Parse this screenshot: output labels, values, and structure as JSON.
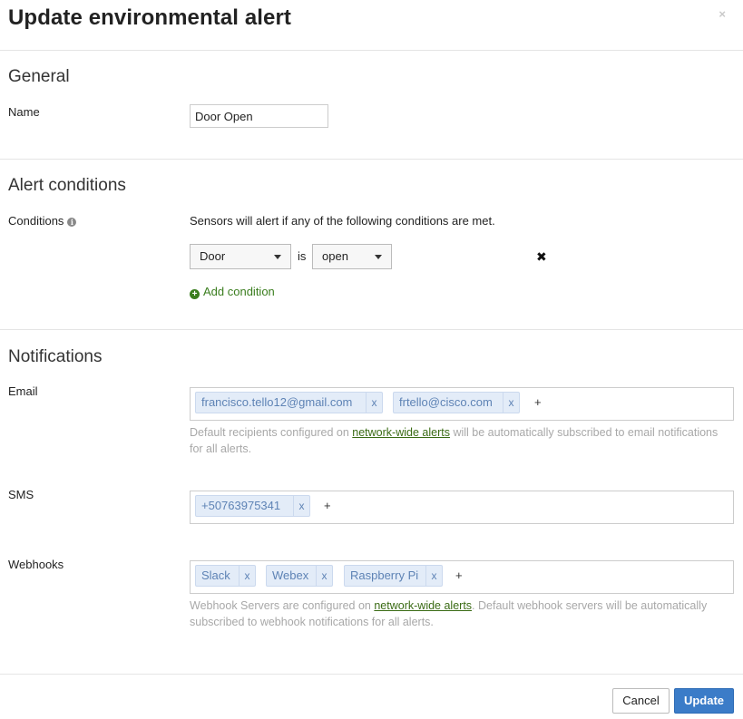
{
  "dialog": {
    "title": "Update environmental alert",
    "close_icon": "×"
  },
  "general": {
    "heading": "General",
    "name_label": "Name",
    "name_value": "Door Open"
  },
  "alert_conditions": {
    "heading": "Alert conditions",
    "conditions_label": "Conditions",
    "info_icon": "i",
    "description": "Sensors will alert if any of the following conditions are met.",
    "sensor_select": "Door",
    "operator": "is",
    "state_select": "open",
    "remove_icon": "✖",
    "add_condition_icon": "+",
    "add_condition": "Add condition"
  },
  "notifications": {
    "heading": "Notifications",
    "email_label": "Email",
    "emails": [
      "francisco.tello12@gmail.com",
      "frtello@cisco.com"
    ],
    "email_help_before": "Default recipients configured on ",
    "email_help_link": "network-wide alerts",
    "email_help_after": " will be automatically subscribed to email notifications for all alerts.",
    "sms_label": "SMS",
    "sms": [
      "+50763975341"
    ],
    "webhooks_label": "Webhooks",
    "webhooks": [
      "Slack",
      "Webex",
      "Raspberry Pi"
    ],
    "webhook_help_before": "Webhook Servers are configured on ",
    "webhook_help_link": "network-wide alerts",
    "webhook_help_after": ". Default webhook servers will be automatically subscribed to webhook notifications for all alerts.",
    "tag_remove": "x",
    "tag_add": "+"
  },
  "footer": {
    "cancel": "Cancel",
    "update": "Update"
  },
  "colors": {
    "primary": "#3b7cc8",
    "link_green": "#3a7d1e",
    "tag_bg": "#e3ecf8",
    "tag_text": "#5e83b5"
  }
}
